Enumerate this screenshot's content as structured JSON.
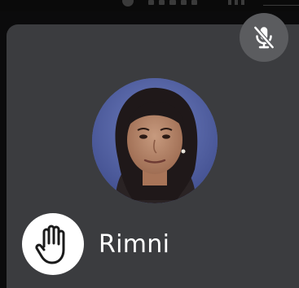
{
  "participant": {
    "name": "Rimni",
    "hand_raised": true,
    "mic_muted": true
  },
  "icons": {
    "mute": "mic-off-icon",
    "hand": "hand-raised-icon",
    "avatar": "avatar"
  },
  "colors": {
    "tile_background": "#3b3c3f",
    "mute_badge_background": "#5b5c5f",
    "hand_badge_background": "#ffffff",
    "name_text": "#ffffff"
  }
}
